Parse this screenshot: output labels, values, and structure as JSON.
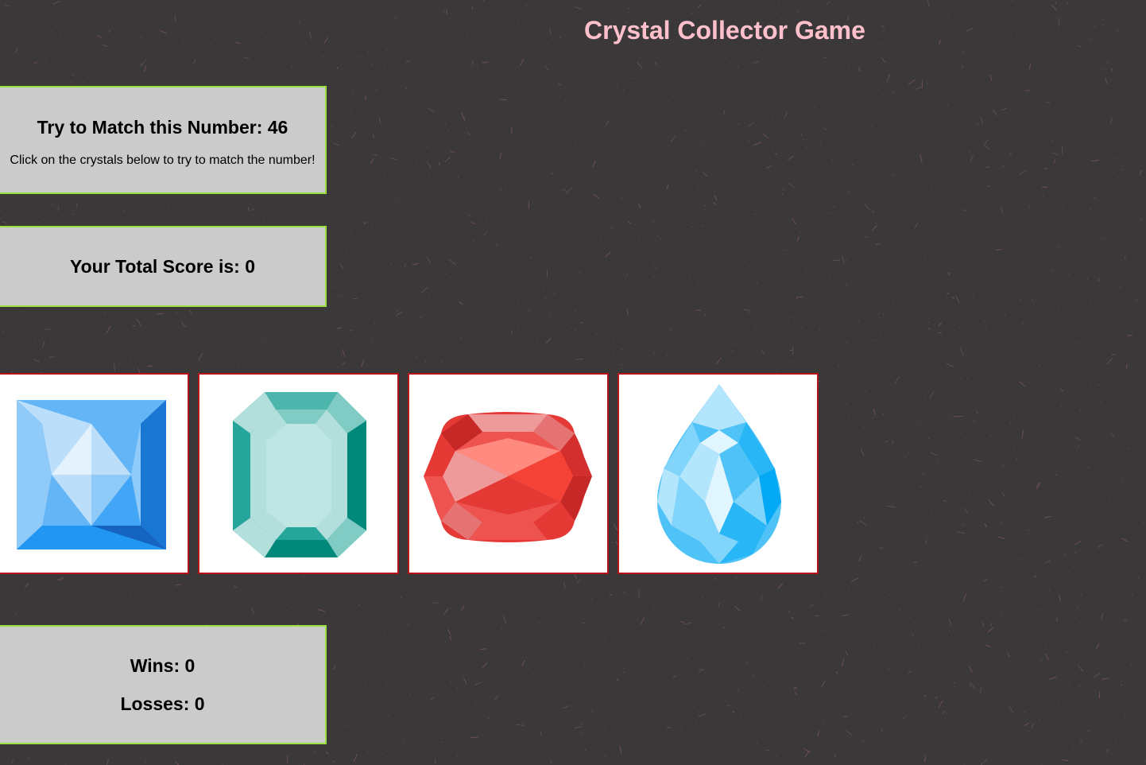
{
  "game": {
    "title": "Crystal Collector Game",
    "target_label": "Try to Match this Number: 46",
    "instructions": "Click on the crystals below to try to match the number!",
    "score_label": "Your Total Score is: 0",
    "wins_label": "Wins: 0",
    "losses_label": "Losses: 0"
  },
  "crystals": [
    {
      "icon": "blue-square-gem-icon"
    },
    {
      "icon": "teal-emerald-cut-gem-icon"
    },
    {
      "icon": "red-cushion-cut-gem-icon"
    },
    {
      "icon": "light-blue-pear-cut-gem-icon"
    }
  ],
  "colors": {
    "background": "#3a3839",
    "title": "#ffc0cb",
    "panel": "#cbcbcb",
    "panel_border": "#9be041",
    "crystal_border": "#b5121b"
  }
}
